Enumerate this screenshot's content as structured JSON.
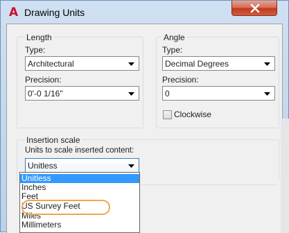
{
  "window": {
    "title": "Drawing Units",
    "app_icon": "A",
    "close_glyph": "x"
  },
  "length": {
    "group_label": "Length",
    "type_label": "Type:",
    "type_value": "Architectural",
    "precision_label": "Precision:",
    "precision_value": "0'-0 1/16\""
  },
  "angle": {
    "group_label": "Angle",
    "type_label": "Type:",
    "type_value": "Decimal Degrees",
    "precision_label": "Precision:",
    "precision_value": "0",
    "clockwise_label": "Clockwise",
    "clockwise_checked": false
  },
  "insertion": {
    "group_label": "Insertion scale",
    "units_label": "Units to scale inserted content:",
    "selected_value": "Unitless",
    "options": [
      {
        "label": "Unitless",
        "selected": true
      },
      {
        "label": "Inches",
        "selected": false
      },
      {
        "label": "Feet",
        "selected": false
      },
      {
        "label": "US Survey Feet",
        "selected": false,
        "highlighted": true
      },
      {
        "label": "Miles",
        "selected": false
      },
      {
        "label": "Millimeters",
        "selected": false
      }
    ]
  },
  "colors": {
    "selection": "#3399ff",
    "highlight_ring": "#f0a64a",
    "app_icon": "#c8102e",
    "close_button": "#c0391f"
  }
}
